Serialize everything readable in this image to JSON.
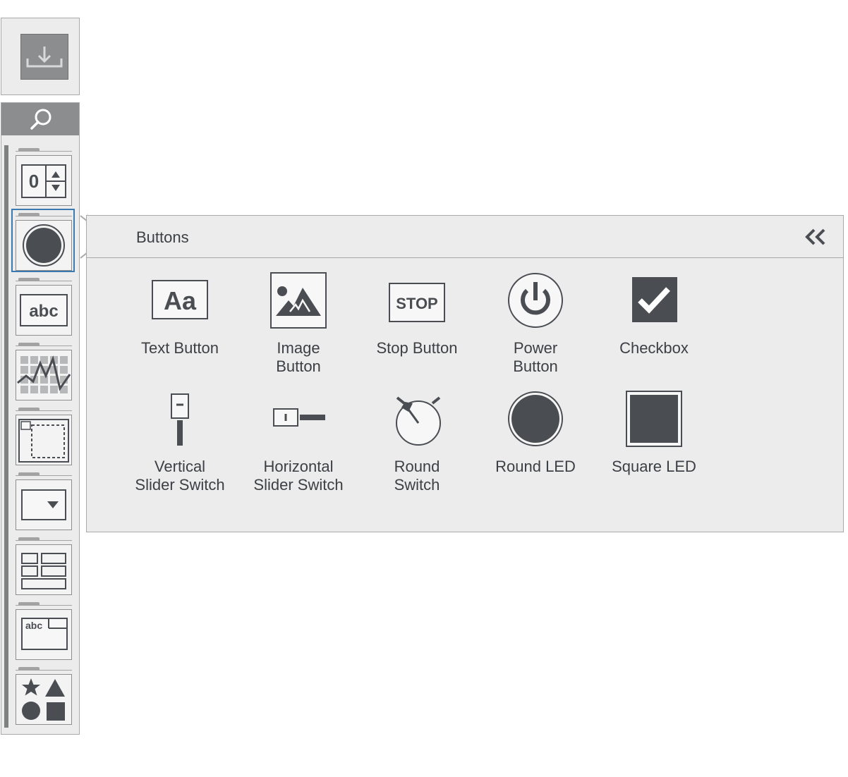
{
  "toolbar": {
    "save_icon": "download-icon"
  },
  "palette": {
    "search_icon": "search-icon",
    "categories": [
      {
        "name": "numeric-category",
        "icon": "numeric-spinner-icon",
        "glyph": "0"
      },
      {
        "name": "buttons-category",
        "icon": "round-button-icon",
        "selected": true
      },
      {
        "name": "text-category",
        "icon": "text-abc-icon",
        "glyph": "abc"
      },
      {
        "name": "graphs-category",
        "icon": "graph-icon"
      },
      {
        "name": "containers-category",
        "icon": "container-icon"
      },
      {
        "name": "list-category",
        "icon": "dropdown-icon"
      },
      {
        "name": "layout-category",
        "icon": "layout-grid-icon"
      },
      {
        "name": "decorations-text-category",
        "icon": "text-window-icon",
        "glyph": "abc"
      },
      {
        "name": "shapes-category",
        "icon": "shapes-icon"
      }
    ]
  },
  "panel": {
    "title": "Buttons",
    "collapse_icon": "double-chevron-left-icon",
    "items": [
      {
        "label": "Text Button",
        "icon": "text-button-icon",
        "glyph": "Aa"
      },
      {
        "label": "Image\nButton",
        "icon": "image-button-icon"
      },
      {
        "label": "Stop Button",
        "icon": "stop-button-icon",
        "glyph": "STOP"
      },
      {
        "label": "Power\nButton",
        "icon": "power-button-icon"
      },
      {
        "label": "Checkbox",
        "icon": "checkbox-icon"
      },
      {
        "label": "Vertical\nSlider Switch",
        "icon": "vertical-slider-switch-icon"
      },
      {
        "label": "Horizontal\nSlider Switch",
        "icon": "horizontal-slider-switch-icon"
      },
      {
        "label": "Round\nSwitch",
        "icon": "round-switch-icon"
      },
      {
        "label": "Round LED",
        "icon": "round-led-icon"
      },
      {
        "label": "Square LED",
        "icon": "square-led-icon"
      }
    ]
  },
  "colors": {
    "accent": "#3a7ab0",
    "icon_dark": "#4a4d52",
    "panel_bg": "#ececec",
    "bar_gray": "#8c8d8f"
  }
}
